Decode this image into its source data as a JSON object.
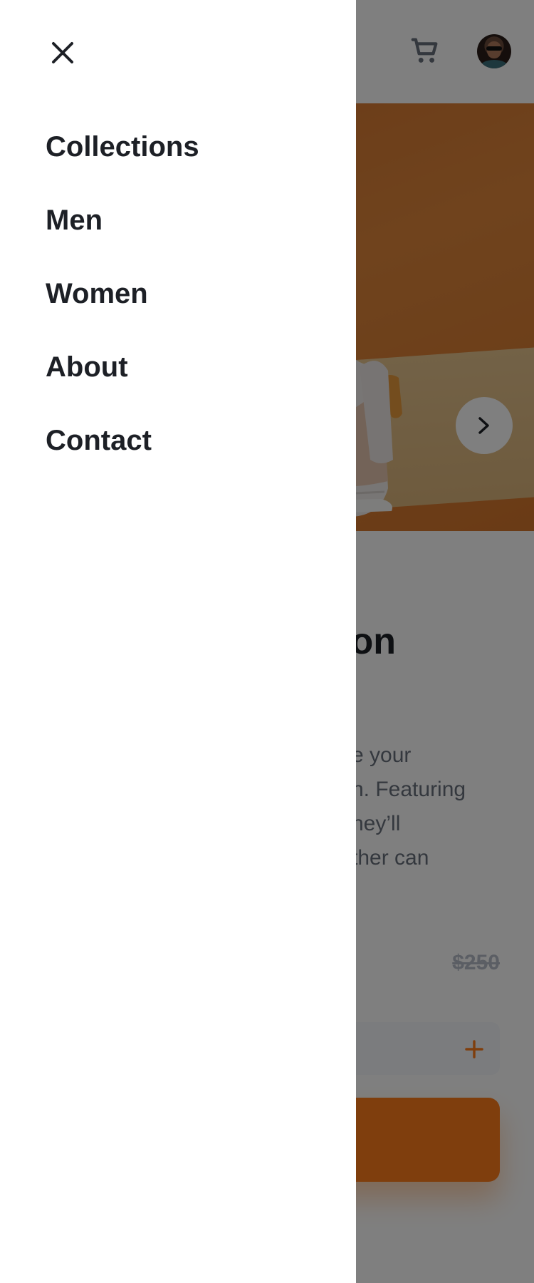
{
  "drawer": {
    "menu_items": [
      {
        "label": "Collections"
      },
      {
        "label": "Men"
      },
      {
        "label": "Women"
      },
      {
        "label": "About"
      },
      {
        "label": "Contact"
      }
    ]
  },
  "product": {
    "title_visible": "on",
    "description_visible": "e your\nn. Featuring\nhey’ll\nther can",
    "price_old": "$250"
  },
  "icons": {
    "close": "close-icon",
    "cart": "cart-icon",
    "avatar": "avatar",
    "next": "chevron-right-icon",
    "plus": "plus-icon"
  },
  "colors": {
    "accent": "#ff7d1a",
    "text_dark": "#1d2026",
    "text_muted": "#68707d",
    "overlay": "rgba(0,0,0,0.5)"
  }
}
